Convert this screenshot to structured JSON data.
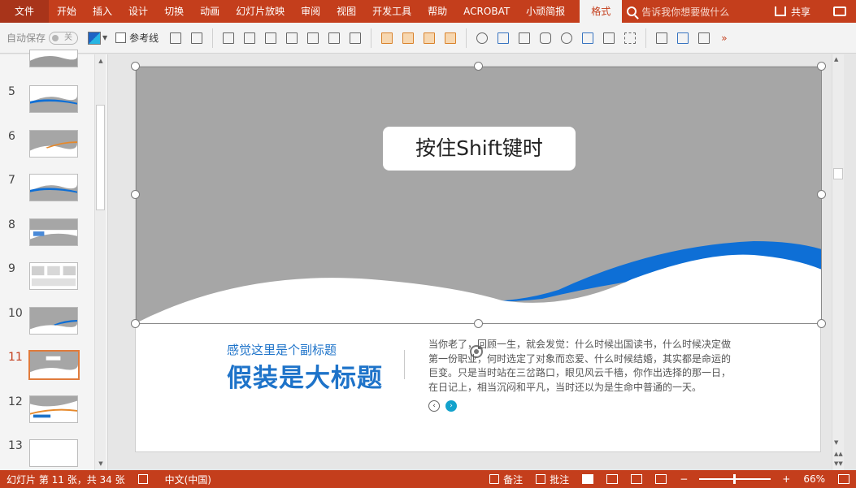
{
  "ribbon": {
    "file": "文件",
    "tabs": [
      "开始",
      "插入",
      "设计",
      "切换",
      "动画",
      "幻灯片放映",
      "审阅",
      "视图",
      "开发工具",
      "帮助",
      "ACROBAT",
      "小顽简报"
    ],
    "active_tab": "格式",
    "tell_me": "告诉我你想要做什么",
    "share": "共享"
  },
  "toolbar": {
    "autosave": "自动保存",
    "toggle": "关",
    "guides": "参考线"
  },
  "slides": [
    {
      "num": "5",
      "style": "blue-wave"
    },
    {
      "num": "6",
      "style": "gray-orange"
    },
    {
      "num": "7",
      "style": "blue-wave"
    },
    {
      "num": "8",
      "style": "gray-band"
    },
    {
      "num": "9",
      "style": "photos"
    },
    {
      "num": "10",
      "style": "gray-blue"
    },
    {
      "num": "11",
      "style": "current",
      "active": true
    },
    {
      "num": "12",
      "style": "orange-wave"
    },
    {
      "num": "13",
      "style": "blank"
    }
  ],
  "slide": {
    "callout": "按住Shift键时",
    "subtitle": "感觉这里是个副标题",
    "title": "假装是大标题",
    "paragraph": [
      "当你老了，回顾一生，就会发觉：什么时候出国读书，什么时候决定做",
      "第一份职业，何时选定了对象而恋爱、什么时候结婚，其实都是命运的",
      "巨变。只是当时站在三岔路口，眼见风云千樯，你作出选择的那一日，",
      "在日记上，相当沉闷和平凡，当时还以为是生命中普通的一天。"
    ],
    "colors": {
      "gray": "#a6a6a6",
      "blue": "#0e6fd6",
      "accent": "#1e73c9",
      "nav": "#13a2cc"
    }
  },
  "status": {
    "slide_info": "幻灯片 第 11 张，共 34 张",
    "language": "中文(中国)",
    "notes": "备注",
    "comments": "批注",
    "zoom": "66%"
  }
}
